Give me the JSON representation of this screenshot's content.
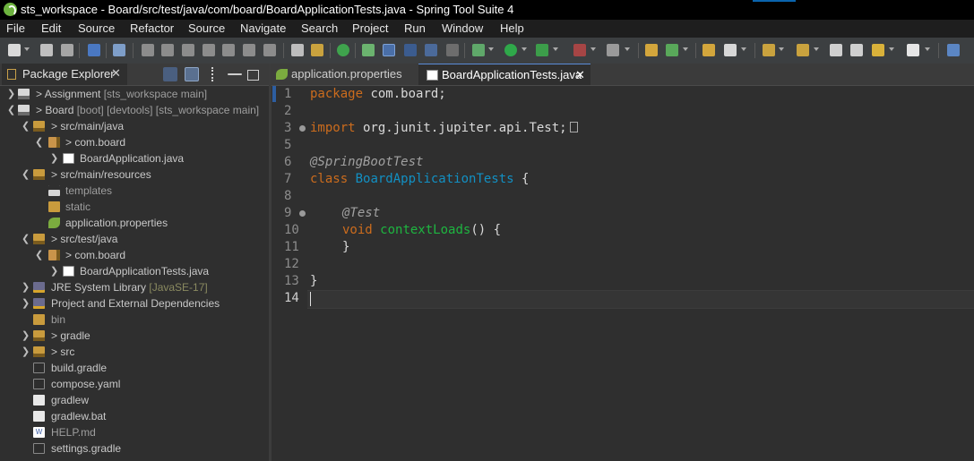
{
  "window": {
    "title": "sts_workspace - Board/src/test/java/com/board/BoardApplicationTests.java - Spring Tool Suite 4"
  },
  "menu": [
    "File",
    "Edit",
    "Source",
    "Refactor",
    "Source",
    "Navigate",
    "Search",
    "Project",
    "Run",
    "Window",
    "Help"
  ],
  "package_explorer": {
    "tab_label": "Package Explorer",
    "close_glyph": "✕",
    "tree": [
      {
        "name": "Assignment",
        "decor": " [sts_workspace main]",
        "prefix": "> "
      },
      {
        "name": "Board",
        "decor": " [boot] [devtools] [sts_workspace main]",
        "prefix": "> "
      },
      {
        "name": "src/main/java",
        "decor": "",
        "prefix": "> "
      },
      {
        "name": "com.board",
        "decor": "",
        "prefix": "> "
      },
      {
        "name": "BoardApplication.java",
        "decor": "",
        "prefix": "> "
      },
      {
        "name": "src/main/resources",
        "decor": "",
        "prefix": "> "
      },
      {
        "name": "templates",
        "decor": "",
        "prefix": ""
      },
      {
        "name": "static",
        "decor": "",
        "prefix": ""
      },
      {
        "name": "application.properties",
        "decor": "",
        "prefix": ""
      },
      {
        "name": "src/test/java",
        "decor": "",
        "prefix": "> "
      },
      {
        "name": "com.board",
        "decor": "",
        "prefix": "> "
      },
      {
        "name": "BoardApplicationTests.java",
        "decor": "",
        "prefix": "> "
      },
      {
        "name": "JRE System Library",
        "decor": " [JavaSE-17]",
        "prefix": ""
      },
      {
        "name": "Project and External Dependencies",
        "decor": "",
        "prefix": ""
      },
      {
        "name": "bin",
        "decor": "",
        "prefix": ""
      },
      {
        "name": "gradle",
        "decor": "",
        "prefix": "> "
      },
      {
        "name": "src",
        "decor": "",
        "prefix": "> "
      },
      {
        "name": "build.gradle",
        "decor": "",
        "prefix": ""
      },
      {
        "name": "compose.yaml",
        "decor": "",
        "prefix": ""
      },
      {
        "name": "gradlew",
        "decor": "",
        "prefix": ""
      },
      {
        "name": "gradlew.bat",
        "decor": "",
        "prefix": ""
      },
      {
        "name": "HELP.md",
        "decor": "",
        "prefix": ""
      },
      {
        "name": "settings.gradle",
        "decor": "",
        "prefix": ""
      }
    ]
  },
  "editor": {
    "tabs": [
      {
        "label": "application.properties"
      },
      {
        "label": "BoardApplicationTests.java",
        "close": "✕"
      }
    ],
    "line_numbers": [
      "1",
      "2",
      "3",
      "5",
      "6",
      "7",
      "8",
      "9",
      "10",
      "11",
      "12",
      "13",
      "14"
    ],
    "code": {
      "l1_kw": "package",
      "l1_rest": " com.board;",
      "l3_kw": "import",
      "l3_rest": " org.junit.jupiter.api.Test;",
      "l6_ann": "@SpringBootTest",
      "l7_kw": "class",
      "l7_cls": "BoardApplicationTests",
      "l7_rest": " {",
      "l9_ann": "@Test",
      "l10_kw": "void",
      "l10_mth": "contextLoads",
      "l10_rest": "() {",
      "l11": "}",
      "l13": "}"
    }
  },
  "colors": {
    "keyword": "#cc6c1d",
    "class_name": "#1290c3",
    "method": "#1eb540",
    "annotation": "#a0a0a0"
  }
}
